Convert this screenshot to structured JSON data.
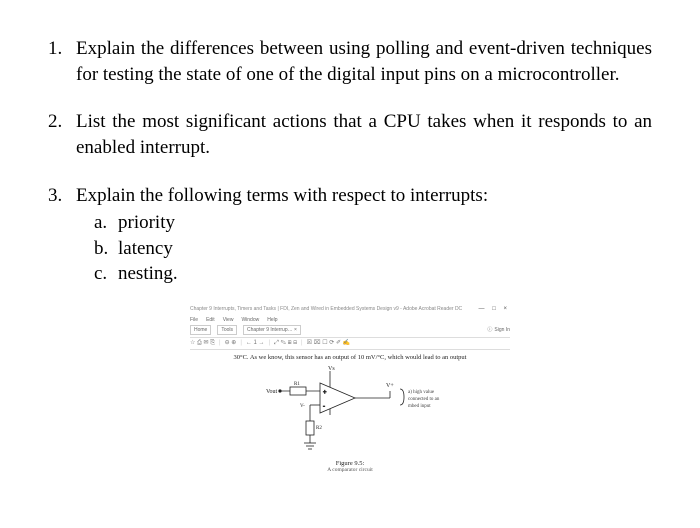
{
  "questions": {
    "q1": {
      "num": "1.",
      "text": "Explain the differences between using polling and event-driven techniques for testing the state of one of the digital input pins on a microcontroller."
    },
    "q2": {
      "num": "2.",
      "text": "List the most significant actions that a CPU takes when it responds to an enabled interrupt."
    },
    "q3": {
      "num": "3.",
      "text": "Explain the following terms with respect to interrupts:",
      "subs": {
        "a": {
          "letter": "a.",
          "label": "priority"
        },
        "b": {
          "letter": "b.",
          "label": "latency"
        },
        "c": {
          "letter": "c.",
          "label": "nesting."
        }
      }
    }
  },
  "figure": {
    "chrome": {
      "titlebar": "Chapter 9 Interrupts, Timers and Tasks | FDI, Zen and Wired in Embedded Systems Design v9 - Adobe Acrobat Reader DC",
      "winbtns": "—  □  ×",
      "menu": {
        "file": "File",
        "edit": "Edit",
        "view": "View",
        "window": "Window",
        "help": "Help"
      },
      "tabs": {
        "home": "Home",
        "tools": "Tools",
        "doc": "Chapter 9 Interrup…  ×"
      },
      "signin": {
        "icon": "ⓘ",
        "label": "Sign In"
      },
      "toolbar": {
        "g1": "☆  ⎙  ✉  ⎘",
        "g2": "⊖ ⊕",
        "g3": "← 1 →",
        "g4": "⤢  ✎  ⊞  ⊟",
        "g5": "☒  ⌧  ☐  ⟳  ✐  ✍"
      }
    },
    "bodytext": "30°C. As we know, this sensor has an output of 10 mV/°C, which would lead to an output",
    "labels": {
      "vs": "Vs",
      "vp": "V+",
      "vout": "Vout",
      "vm": "V-",
      "r1": "R1",
      "r2": "R2",
      "note1": "a) high value",
      "note2": "connected to an",
      "note3": "mbed input"
    },
    "caption": "Figure 9.5:",
    "subcaption": "A comparator circuit"
  }
}
